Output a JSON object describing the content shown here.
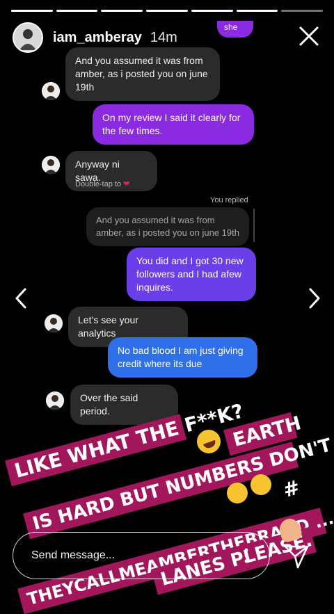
{
  "story": {
    "username": "iam_amberay",
    "time": "14m",
    "segments": 7,
    "active_segment": 6
  },
  "chat": {
    "top_partial": "she",
    "messages": [
      {
        "side": "received",
        "text": "And you assumed it was from amber, as i posted you on june 19th"
      },
      {
        "side": "sent",
        "text": "On my review I said it clearly for the few times."
      },
      {
        "side": "received",
        "text": "Anyway ni sawa."
      },
      {
        "side": "sent",
        "text": "You did and I got 30 new followers and I had afew inquires."
      },
      {
        "side": "received",
        "text": "Let’s see your analytics"
      },
      {
        "side": "sent",
        "text": "No bad blood I am just giving credit where its due"
      },
      {
        "side": "received",
        "text": "Over the said period."
      }
    ],
    "double_tap": "Double-tap to",
    "you_replied": "You replied",
    "quoted": "And you assumed it was from amber, as i posted you on june 19th"
  },
  "caption": {
    "line1": "LIKE WHAT THE F**K?",
    "line1b": "EARTH",
    "line2": "IS HARD BUT NUMBERS DON'T LIE",
    "line3": "#",
    "line4": "THEYCALLMEAMBERTHEBRAND ....",
    "line5": "LANES PLEASE."
  },
  "reply": {
    "placeholder": "Send message..."
  },
  "colors": {
    "purple": "#8a2be2",
    "violet": "#6a3ee8",
    "blue": "#2f6fe8",
    "sticker": "#a2175c"
  }
}
